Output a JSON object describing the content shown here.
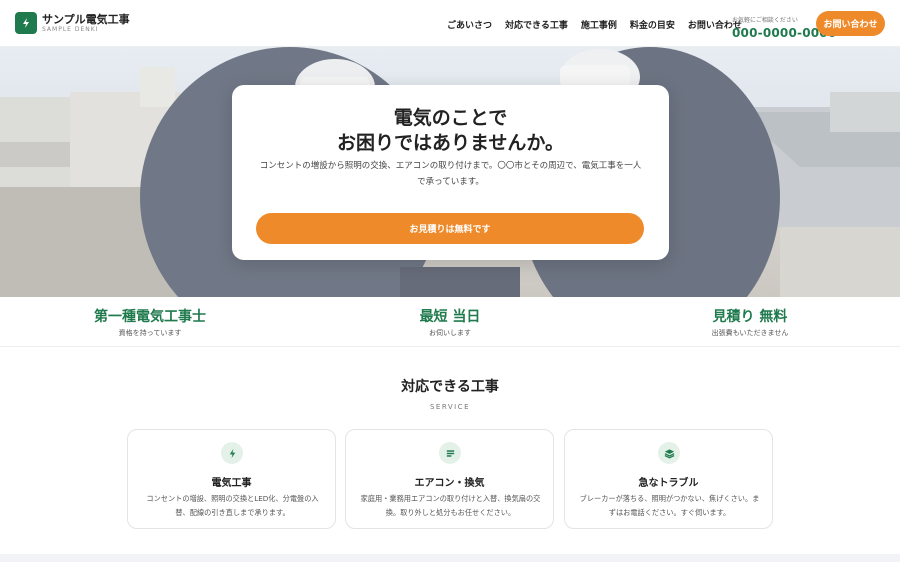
{
  "colors": {
    "brand_green": "#1f7a4d",
    "accent_orange": "#ef8a2a"
  },
  "header": {
    "logo_icon": "lightning-icon",
    "name": "サンプル電気工事",
    "sub": "SAMPLE DENKI",
    "nav": [
      "ごあいさつ",
      "対応できる工事",
      "施工事例",
      "料金の目安",
      "お問い合わせ"
    ],
    "consult_label": "お気軽にご相談ください",
    "phone": "000-0000-0000",
    "cta": "お問い合わせ"
  },
  "hero": {
    "title_line1": "電気のことで",
    "title_line2": "お困りではありませんか。",
    "description": "コンセントの増設から照明の交換、エアコンの取り付けまで。〇〇市とその周辺で、電気工事を一人で承っています。",
    "cta": "お見積りは無料です"
  },
  "features": [
    {
      "title": "第一種電気工事士",
      "sub": "資格を持っています"
    },
    {
      "title": "最短 当日",
      "sub": "お伺いします"
    },
    {
      "title": "見積り 無料",
      "sub": "出張費もいただきません"
    }
  ],
  "services": {
    "title": "対応できる工事",
    "sub": "SERVICE",
    "cards": [
      {
        "icon": "lightning-icon",
        "title": "電気工事",
        "desc": "コンセントの増設、照明の交換とLED化、分電盤の入替、配線の引き直しまで承ります。"
      },
      {
        "icon": "list-icon",
        "title": "エアコン・換気",
        "desc": "家庭用・業務用エアコンの取り付けと入替、換気扇の交換。取り外しと処分もお任せください。"
      },
      {
        "icon": "layers-icon",
        "title": "急なトラブル",
        "desc": "ブレーカーが落ちる、照明がつかない、焦げくさい。まずはお電話ください。すぐ伺います。"
      }
    ]
  }
}
